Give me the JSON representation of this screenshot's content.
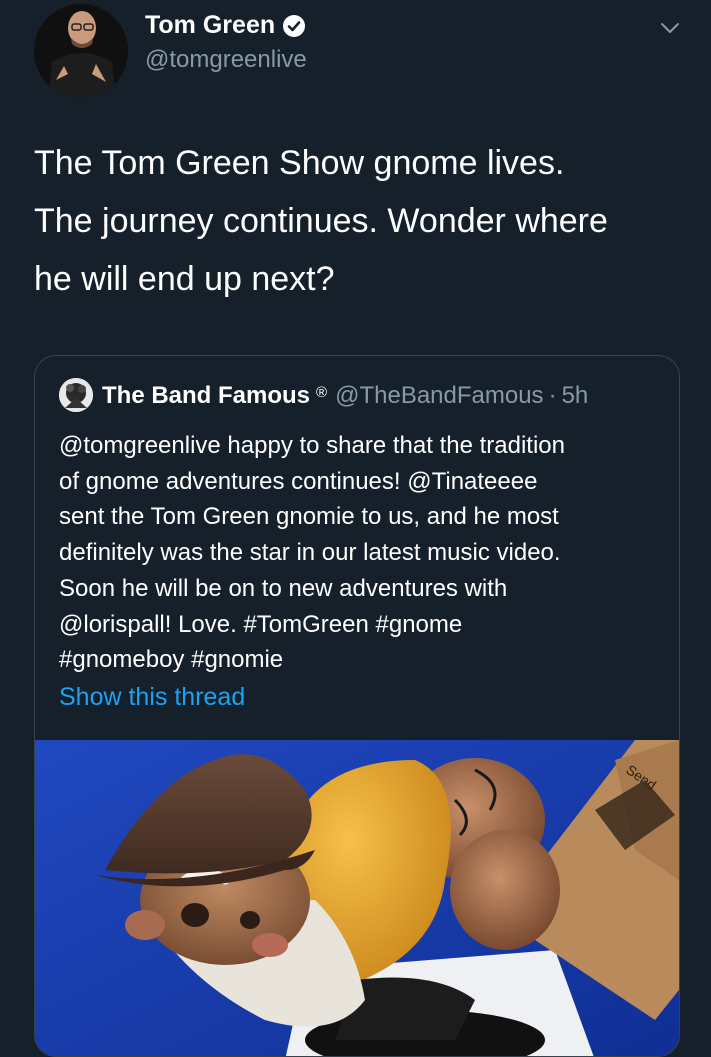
{
  "author": {
    "display_name": "Tom Green",
    "handle": "@tomgreenlive",
    "icons": {
      "avatar": "user-avatar-photo",
      "verified": "verified-badge-icon",
      "menu": "chevron-down-icon"
    }
  },
  "tweet": {
    "lines": [
      "The Tom Green Show gnome lives.",
      "The journey continues.  Wonder where",
      "he will end up next?"
    ]
  },
  "quoted_tweet": {
    "display_name": "The Band Famous",
    "badge": "®",
    "handle": "@TheBandFamous",
    "separator": "·",
    "time": "5h",
    "lines": [
      "@tomgreenlive happy to share that the tradition",
      "of gnome adventures continues! @Tinateeee",
      "sent the Tom Green gnomie to us, and he most",
      "definitely was the star in our latest music video.",
      "Soon he will be on to new adventures with",
      "@lorispall! Love. #TomGreen #gnome",
      "#gnomeboy #gnomie"
    ],
    "show_thread_label": "Show this thread",
    "media": {
      "description_icon": "gnome-photo",
      "box_text": "Send"
    }
  },
  "colors": {
    "background": "#15202b",
    "secondary_text": "#8899a6",
    "link": "#1da1f2",
    "border": "#38444d"
  }
}
